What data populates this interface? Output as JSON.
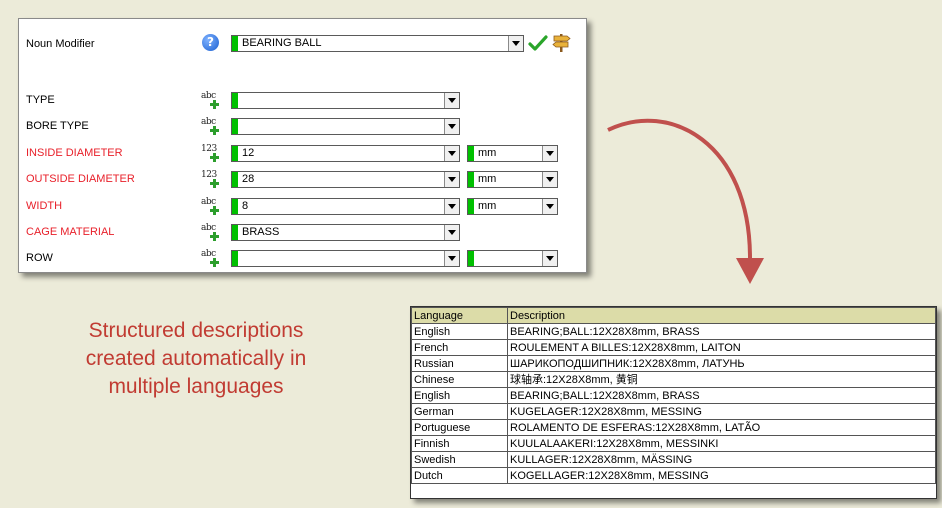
{
  "form": {
    "noun_modifier_label": "Noun Modifier",
    "noun_modifier_value": "BEARING BALL",
    "icons": {
      "help": "help-icon",
      "help_glyph": "?",
      "confirm": "checkmark-icon",
      "signpost": "signpost-icon"
    },
    "rows": [
      {
        "label": "TYPE",
        "required": false,
        "data_type": "abc",
        "value": "",
        "unit": null
      },
      {
        "label": "BORE TYPE",
        "required": false,
        "data_type": "abc",
        "value": "",
        "unit": null
      },
      {
        "label": "INSIDE DIAMETER",
        "required": true,
        "data_type": "123",
        "value": "12",
        "unit": "mm"
      },
      {
        "label": "OUTSIDE DIAMETER",
        "required": true,
        "data_type": "123",
        "value": "28",
        "unit": "mm"
      },
      {
        "label": "WIDTH",
        "required": true,
        "data_type": "abc",
        "value": "8",
        "unit": "mm"
      },
      {
        "label": "CAGE MATERIAL",
        "required": true,
        "data_type": "abc",
        "value": "BRASS",
        "unit": null
      },
      {
        "label": "ROW",
        "required": false,
        "data_type": "abc",
        "value": "",
        "unit": ""
      }
    ],
    "colors": {
      "required_label": "#e8202a",
      "indicator": "#00c000"
    }
  },
  "headline": {
    "line1": "Structured descriptions",
    "line2": "created automatically in",
    "line3": "multiple languages"
  },
  "table": {
    "headers": [
      "Language",
      "Description"
    ],
    "rows": [
      [
        "English",
        "BEARING;BALL:12X28X8mm, BRASS"
      ],
      [
        "French",
        "ROULEMENT A BILLES:12X28X8mm, LAITON"
      ],
      [
        "Russian",
        "ШАРИКОПОДШИПНИК:12X28X8mm, ЛАТУНЬ"
      ],
      [
        "Chinese",
        "球轴承:12X28X8mm, 黄铜"
      ],
      [
        "English",
        "BEARING;BALL:12X28X8mm, BRASS"
      ],
      [
        "German",
        "KUGELAGER:12X28X8mm, MESSING"
      ],
      [
        "Portuguese",
        "ROLAMENTO DE ESFERAS:12X28X8mm, LATÃO"
      ],
      [
        "Finnish",
        "KUULALAAKERI:12X28X8mm, MESSINKI"
      ],
      [
        "Swedish",
        "KULLAGER:12X28X8mm, MÄSSING"
      ],
      [
        "Dutch",
        "KOGELLAGER:12X28X8mm, MESSING"
      ]
    ]
  }
}
